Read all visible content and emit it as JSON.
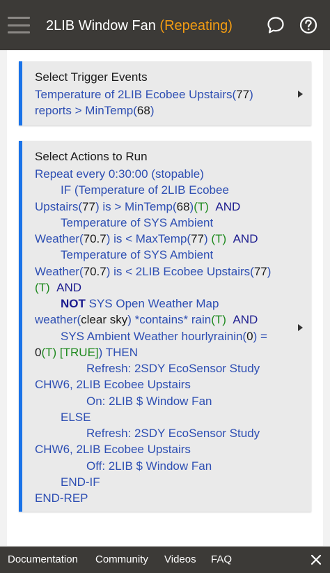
{
  "header": {
    "app_name": "2LIB Window Fan",
    "status": "(Repeating)",
    "icons": {
      "menu": "hamburger-menu-icon",
      "chat": "chat-bubble-icon",
      "help": "help-circle-icon"
    },
    "colors": {
      "bar": "#3c3a37",
      "status": "#f39c12"
    }
  },
  "trigger": {
    "title": "Select Trigger Events",
    "line1": {
      "a": "Temperature of 2LIB Ecobee Upstairs(",
      "b": "77",
      "c": ")"
    },
    "line2": {
      "a": "reports > MinTemp(",
      "b": "68",
      "c": ")"
    }
  },
  "actions": {
    "title": "Select Actions to Run",
    "l1": "Repeat every 0:30:00 (stopable)",
    "l2": {
      "a": "IF (Temperature of 2LIB Ecobee"
    },
    "l3": {
      "a": "Upstairs(",
      "b": "77",
      "c": ") is > MinTemp(",
      "d": "68",
      "e": ")",
      "f": "(T)",
      "g": "AND"
    },
    "l4": {
      "a": "Temperature of SYS Ambient"
    },
    "l5": {
      "a": "Weather(",
      "b": "70.7",
      "c": ") is < MaxTemp(",
      "d": "77",
      "e": ")",
      "f": "(T)",
      "g": "AND"
    },
    "l6": {
      "a": "Temperature of SYS Ambient"
    },
    "l7": {
      "a": "Weather(",
      "b": "70.7",
      "c": ") is < 2LIB Ecobee Upstairs(",
      "d": "77",
      "e": ")"
    },
    "l8": {
      "a": "(T)",
      "b": "AND"
    },
    "l9": {
      "a": "NOT",
      "b": " SYS Open Weather Map"
    },
    "l10": {
      "a": "weather(",
      "b": "clear sky",
      "c": ") *contains* rain",
      "d": "(T)",
      "e": "AND"
    },
    "l11": {
      "a": "SYS Ambient Weather hourlyrainin(",
      "b": "0",
      "c": ") ="
    },
    "l12": {
      "a": "0",
      "b": "(T)",
      "c": "[TRUE]",
      "d": ") THEN"
    },
    "l13": "Refresh: 2SDY EcoSensor Study",
    "l14": "CHW6, 2LIB Ecobee Upstairs",
    "l15": "On: 2LIB $ Window Fan",
    "l16": "ELSE",
    "l17": "Refresh: 2SDY EcoSensor Study",
    "l18": "CHW6, 2LIB Ecobee Upstairs",
    "l19": "Off: 2LIB $ Window Fan",
    "l20": "END-IF",
    "l21": "END-REP"
  },
  "footer": {
    "links": [
      "Documentation",
      "Community",
      "Videos",
      "FAQ"
    ],
    "close_icon": "close-x-icon"
  }
}
